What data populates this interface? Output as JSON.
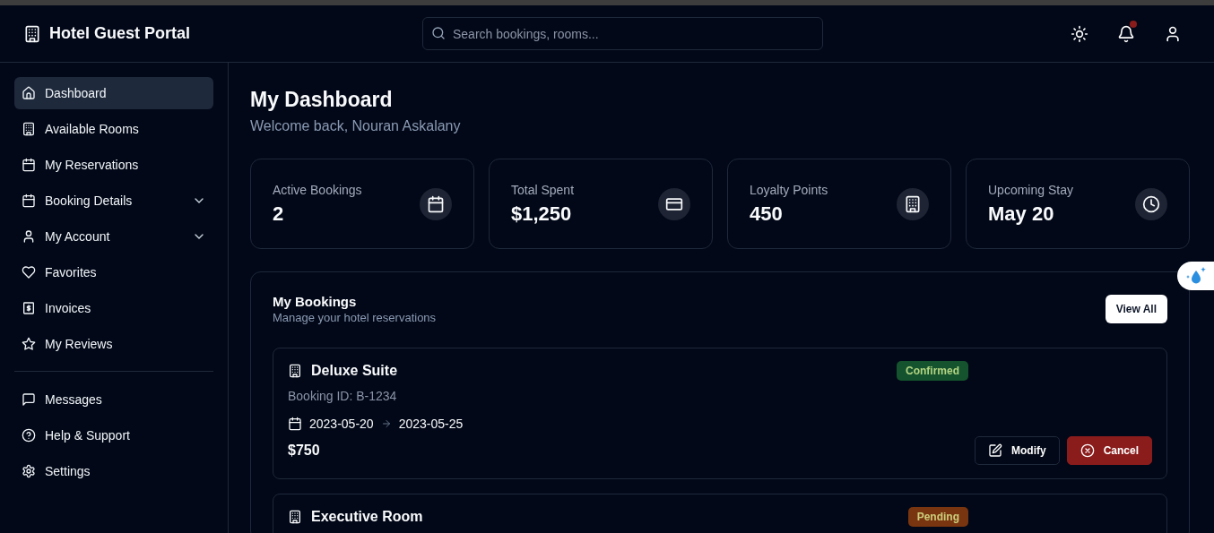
{
  "header": {
    "title": "Hotel Guest Portal",
    "search": {
      "placeholder": "Search bookings, rooms..."
    },
    "notifications_unread": true
  },
  "sidebar": {
    "groups": [
      [
        {
          "label": "Dashboard",
          "selected": true,
          "has_submenu": false
        },
        {
          "label": "Available Rooms",
          "selected": false,
          "has_submenu": false
        },
        {
          "label": "My Reservations",
          "selected": false,
          "has_submenu": false
        },
        {
          "label": "Booking Details",
          "selected": false,
          "has_submenu": true
        },
        {
          "label": "My Account",
          "selected": false,
          "has_submenu": true
        },
        {
          "label": "Favorites",
          "selected": false,
          "has_submenu": false
        },
        {
          "label": "Invoices",
          "selected": false,
          "has_submenu": false
        },
        {
          "label": "My Reviews",
          "selected": false,
          "has_submenu": false
        }
      ],
      [
        {
          "label": "Messages",
          "selected": false,
          "has_submenu": false
        },
        {
          "label": "Help & Support",
          "selected": false,
          "has_submenu": false
        },
        {
          "label": "Settings",
          "selected": false,
          "has_submenu": false
        }
      ]
    ]
  },
  "page": {
    "title": "My Dashboard",
    "subtitle": "Welcome back, Nouran Askalany"
  },
  "stats": [
    {
      "label": "Active Bookings",
      "value": "2"
    },
    {
      "label": "Total Spent",
      "value": "$1,250"
    },
    {
      "label": "Loyalty Points",
      "value": "450"
    },
    {
      "label": "Upcoming Stay",
      "value": "May 20"
    }
  ],
  "bookings": {
    "title": "My Bookings",
    "subtitle": "Manage your hotel reservations",
    "view_all": "View All",
    "items": [
      {
        "room": "Deluxe Suite",
        "status": "Confirmed",
        "color": "#14532d",
        "booking_id": "Booking ID: B-1234",
        "check_in": "2023-05-20",
        "check_out": "2023-05-25",
        "price": "$750",
        "actions": [
          "Modify",
          "Cancel"
        ]
      },
      {
        "room": "Executive Room",
        "status": "Pending",
        "color": "#78350f"
      }
    ]
  }
}
